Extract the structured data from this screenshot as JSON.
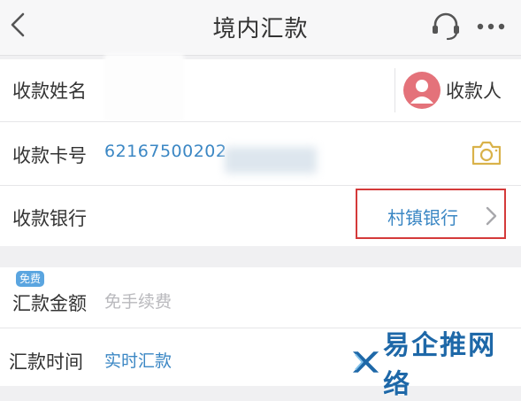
{
  "header": {
    "title": "境内汇款"
  },
  "form": {
    "payee_name_label": "收款姓名",
    "payee_contact_label": "收款人",
    "card_number_label": "收款卡号",
    "card_number_value": "62167500202",
    "bank_label": "收款银行",
    "bank_value": "村镇银行",
    "amount_label": "汇款金额",
    "amount_badge": "免费",
    "amount_placeholder": "免手续费",
    "time_label": "汇款时间",
    "time_value": "实时汇款"
  },
  "watermark": {
    "text": "易企推网络"
  },
  "colors": {
    "link_blue": "#3b87c4",
    "highlight_red": "#d43a3a",
    "avatar": "#e4727a",
    "camera": "#d9b24a"
  }
}
